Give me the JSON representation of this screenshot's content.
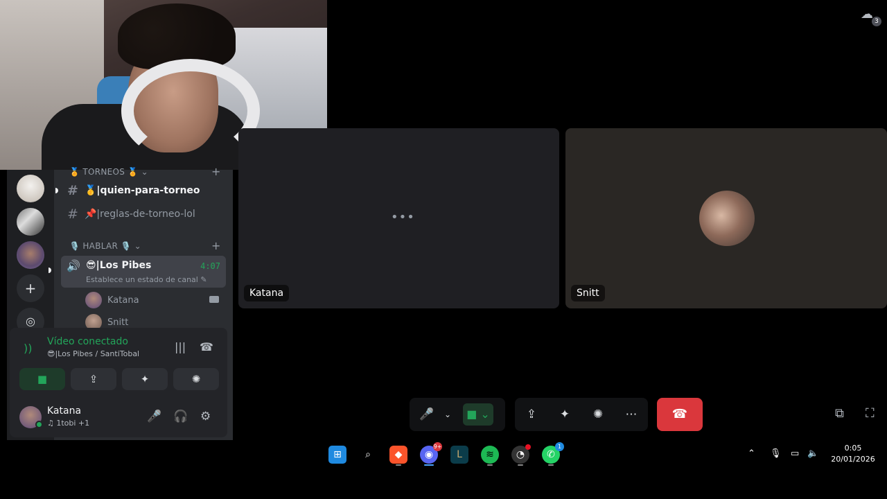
{
  "webcam": {
    "description_icon": "person-video"
  },
  "notifications": {
    "badge": "3"
  },
  "sidebar": {
    "category_torneos": "🏅 TORNEOS 🏅",
    "category_hablar": "🎙️ HABLAR 🎙️",
    "channels": [
      {
        "label": "🥇|quien-para-torneo"
      },
      {
        "label": "📌|reglas-de-torneo-lol"
      }
    ],
    "voice_channel": {
      "name": "😎|Los Pibes",
      "time": "4:07",
      "status": "Establece un estado de canal"
    },
    "voice_users": [
      {
        "name": "Katana"
      },
      {
        "name": "Snitt"
      }
    ]
  },
  "rtc_panel": {
    "title": "Vídeo conectado",
    "subtitle": "😎|Los Pibes / SantiTobal"
  },
  "user": {
    "name": "Katana",
    "activity": "♫ 1tobi +1"
  },
  "tiles": [
    {
      "label": "Katana",
      "loading": "•••"
    },
    {
      "label": "Snitt"
    }
  ],
  "taskbar": {
    "discord_badge": "9+",
    "whatsapp_badge": "1",
    "time": "0:05",
    "date": "20/01/2026"
  },
  "colors": {
    "green": "#23a55a",
    "end_call": "#da373c",
    "sidebar_bg": "#2b2d31"
  }
}
